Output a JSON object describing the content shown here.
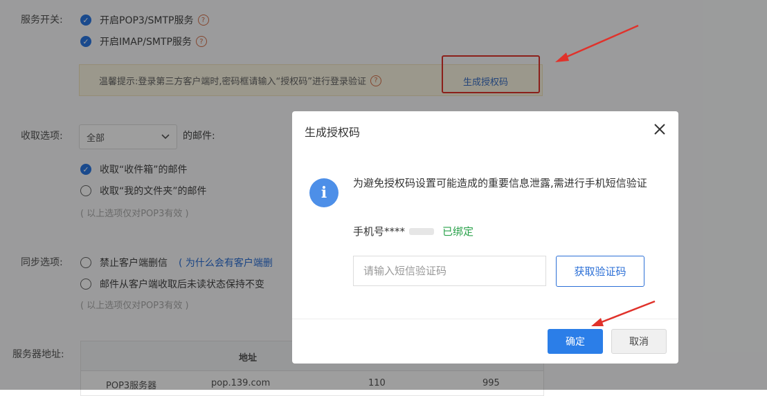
{
  "settings": {
    "service_switch_label": "服务开关:",
    "pop3_option": "开启POP3/SMTP服务",
    "imap_option": "开启IMAP/SMTP服务",
    "tip_text": "温馨提示:登录第三方客户端时,密码框请输入“授权码”进行登录验证",
    "generate_code_link": "生成授权码",
    "receive_label": "收取选项:",
    "receive_select_value": "全部",
    "receive_suffix": "的邮件:",
    "receive_inbox": "收取“收件箱”的邮件",
    "receive_my_folders": "收取“我的文件夹”的邮件",
    "receive_hint": "( 以上选项仅对POP3有效 )",
    "sync_label": "同步选项:",
    "sync_option1": "禁止客户端删信",
    "sync_link": "( 为什么会有客户端删",
    "sync_option2": "邮件从客户端收取后未读状态保持不变",
    "sync_hint": "( 以上选项仅对POP3有效 )",
    "server_label": "服务器地址:",
    "table": {
      "header_address": "地址",
      "row": {
        "name": "POP3服务器",
        "address": "pop.139.com",
        "port1": "110",
        "port2": "995"
      }
    }
  },
  "dialog": {
    "title": "生成授权码",
    "message": "为避免授权码设置可能造成的重要信息泄露,需进行手机短信验证",
    "phone_label": "手机号",
    "phone_masked": "****",
    "bound_status": "已绑定",
    "sms_placeholder": "请输入短信验证码",
    "get_code_button": "获取验证码",
    "confirm_button": "确定",
    "cancel_button": "取消"
  },
  "icons": {
    "checked": "check-icon",
    "help": "question-icon",
    "info": "info-icon",
    "close": "close-icon",
    "dropdown": "chevron-down-icon"
  },
  "colors": {
    "accent": "#2b7ee8",
    "highlight": "#e0322b",
    "bound": "#29a14a"
  }
}
